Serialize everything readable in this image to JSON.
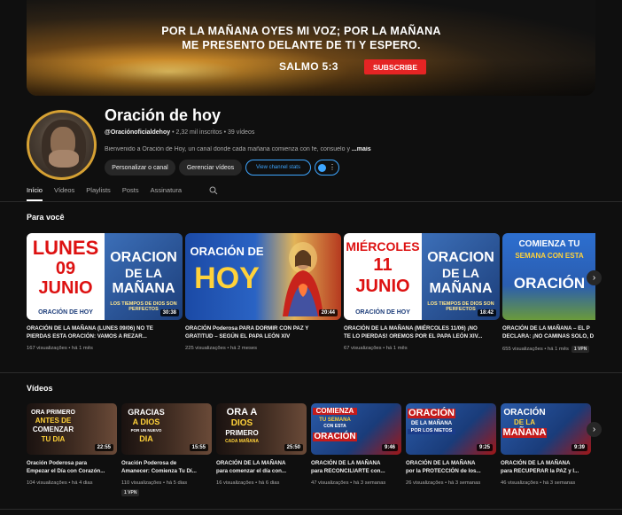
{
  "banner": {
    "line1": "POR LA MAÑANA OYES MI VOZ; POR LA MAÑANA",
    "line2": "ME PRESENTO DELANTE DE TI Y ESPERO.",
    "psalm": "SALMO 5:3",
    "subscribe": "SUBSCRIBE"
  },
  "channel": {
    "title": "Oración de hoy",
    "handle": "@Oraciónoficialdehoy",
    "subscribers": "2,32 mil inscritos",
    "videos": "39 vídeos",
    "description": "Bienvenido a Oración de Hoy, un canal donde cada mañana comienza con fe, consuelo y ",
    "more": "...mais",
    "btn_customize": "Personalizar o canal",
    "btn_manage": "Gerenciar vídeos",
    "btn_stats": "View channel stats"
  },
  "tabs": [
    "Início",
    "Vídeos",
    "Playlists",
    "Posts",
    "Assinatura"
  ],
  "sections": {
    "for_you": "Para você",
    "videos": "Vídeos"
  },
  "for_you": [
    {
      "thumb_line1": "LUNES",
      "thumb_line2": "09",
      "thumb_line3": "JUNIO",
      "thumb_footer": "ORACIÓN DE HOY",
      "thumb_right1": "ORACION",
      "thumb_right2": "DE LA",
      "thumb_right3": "MAÑANA",
      "thumb_right4": "LOS TIEMPOS DE DIOS SON PERFECTOS",
      "duration": "30:38",
      "title1": "ORACIÓN DE LA MAÑANA (LUNES 09/06) NO TE",
      "title2": "PIERDAS ESTA ORACIÓN: VAMOS A REZAR...",
      "views": "167 visualizações",
      "age": "há 1 mês"
    },
    {
      "thumb_line1": "ORACIÓN DE",
      "thumb_line2": "HOY",
      "duration": "20:44",
      "title1": "ORACIÓN Poderosa PARA DORMIR CON PAZ Y",
      "title2": "GRATITUD – SEGÚN EL PAPA LEÓN XIV",
      "views": "225 visualizações",
      "age": "há 2 meses"
    },
    {
      "thumb_line1": "MIÉRCOLES",
      "thumb_line2": "11",
      "thumb_line3": "JUNIO",
      "thumb_footer": "ORACIÓN DE HOY",
      "thumb_right1": "ORACION",
      "thumb_right2": "DE LA",
      "thumb_right3": "MAÑANA",
      "thumb_right4": "LOS TIEMPOS DE DIOS SON PERFECTOS",
      "duration": "18:42",
      "title1": "ORACIÓN DE LA MAÑANA (MIÉRCOLES 11/06) ¡NO",
      "title2": "TE LO PIERDAS! OREMOS POR EL PAPA LEÓN XIV...",
      "views": "67 visualizações",
      "age": "há 1 mês"
    },
    {
      "thumb_line1": "COMIENZA TU",
      "thumb_line2": "SEMANA CON ESTA",
      "thumb_line3": "ORACIÓN",
      "title1": "ORACIÓN DE LA MAÑANA – EL P",
      "title2": "DECLARA: ¡NO CAMINAS SOLO, D",
      "views": "655 visualizações",
      "age": "há 1 mês",
      "badge": "1 VPN"
    }
  ],
  "videos": [
    {
      "cap1": "ORA PRIMERO",
      "cap2": "ANTES DE",
      "cap3": "COMENZAR",
      "cap4": "TU DIA",
      "duration": "22:55",
      "title1": "Oración Poderosa para",
      "title2": "Empezar el Día con Corazón...",
      "views": "104 visualizações",
      "age": "há 4 dias"
    },
    {
      "cap1": "GRACIAS",
      "cap2": "A DIOS",
      "cap3": "POR UN NUEVO",
      "cap4": "DIA",
      "duration": "15:55",
      "title1": "Oración Poderosa de",
      "title2": "Amanecer: Comienza Tu Dí...",
      "views": "110 visualizações",
      "age": "há 5 dias",
      "badge": "1 VPN"
    },
    {
      "cap1": "ORA A",
      "cap2": "DIOS",
      "cap3": "PRIMERO",
      "cap4": "CADA MAÑANA",
      "duration": "25:50",
      "title1": "ORACIÓN DE LA MAÑANA",
      "title2": "para comenzar el día con...",
      "views": "16 visualizações",
      "age": "há 6 dias"
    },
    {
      "cap1": "COMIENZA",
      "cap2": "TU SEMANA",
      "cap3": "CON ESTA",
      "cap4": "ORACIÓN",
      "duration": "9:46",
      "title1": "ORACIÓN DE LA MAÑANA",
      "title2": "para RECONCILIARTE con...",
      "views": "47 visualizações",
      "age": "há 3 semanas"
    },
    {
      "cap1": "ORACIÓN",
      "cap2": "DE LA MAÑANA",
      "cap3": "POR LOS NIETOS",
      "cap4": "",
      "duration": "9:25",
      "title1": "ORACIÓN DE LA MAÑANA",
      "title2": "por la PROTECCIÓN de los...",
      "views": "26 visualizações",
      "age": "há 3 semanas"
    },
    {
      "cap1": "ORACIÓN",
      "cap2": "DE LA",
      "cap3": "MAÑANA",
      "cap4": "",
      "duration": "9:39",
      "title1": "ORACIÓN DE LA MAÑANA",
      "title2": "para RECUPERAR la PAZ y l...",
      "views": "46 visualizações",
      "age": "há 3 semanas"
    }
  ],
  "colors": {
    "accent": "#3ea6ff",
    "subscribe_red": "#e52424",
    "bg": "#0f0f0f"
  }
}
